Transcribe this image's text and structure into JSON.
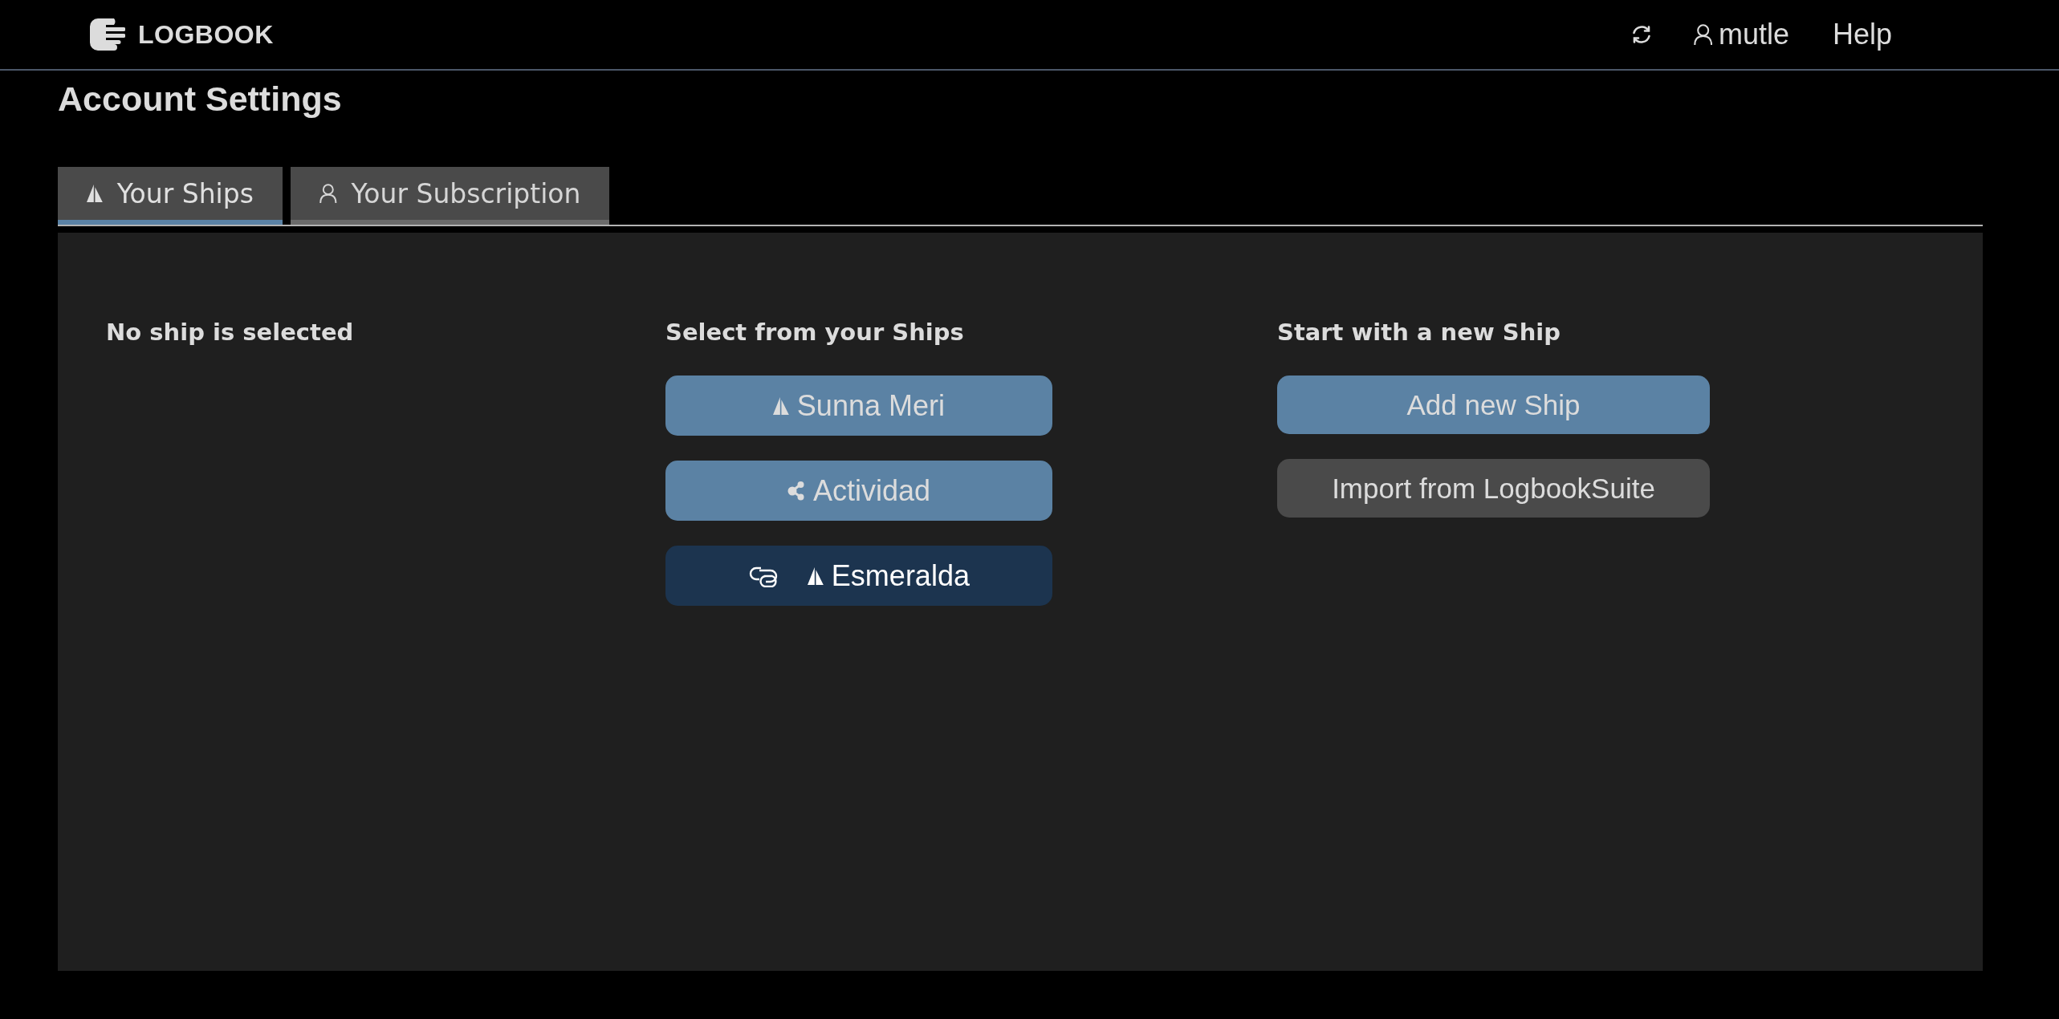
{
  "header": {
    "logo": "LOGBOOK",
    "user": "mutle",
    "help": "Help"
  },
  "page": {
    "title": "Account Settings"
  },
  "tabs": [
    {
      "label": "Your Ships",
      "kind": "ships",
      "selected": true
    },
    {
      "label": "Your Subscription",
      "kind": "subscription",
      "selected": false
    }
  ],
  "status": {
    "heading": "No ship is selected"
  },
  "ships": {
    "heading": "Select from your Ships",
    "items": [
      {
        "name": "Sunna Meri",
        "kind": "boat",
        "linked": false
      },
      {
        "name": "Actividad",
        "kind": "group",
        "linked": false
      },
      {
        "name": "Esmeralda",
        "kind": "boat",
        "linked": true
      }
    ]
  },
  "new_ship": {
    "heading": "Start with a new Ship",
    "buttons": [
      {
        "label": "Add new Ship",
        "kind": "primary"
      },
      {
        "label": "Import from LogbookSuite",
        "kind": "secondary"
      }
    ]
  }
}
